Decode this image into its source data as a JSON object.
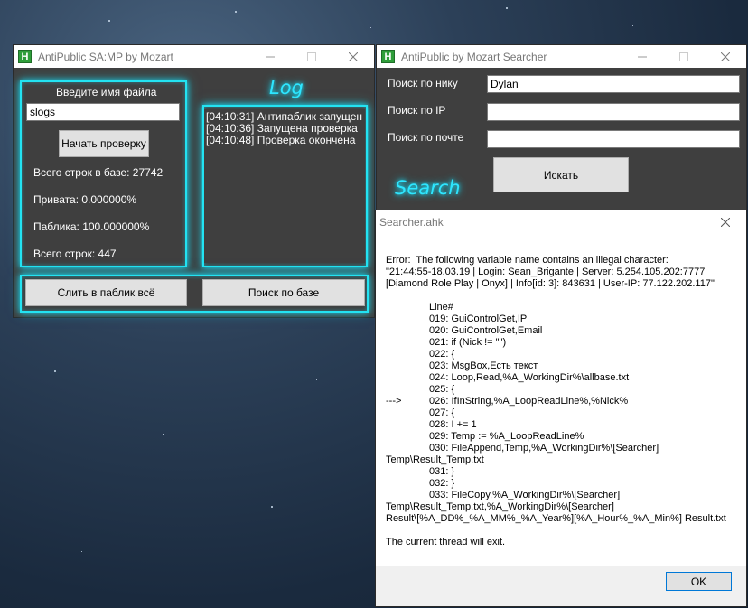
{
  "main_window": {
    "title": "AntiPublic SA:MP by Mozart",
    "file_label": "Введите имя файла",
    "file_value": "slogs",
    "check_button": "Начать проверку",
    "stats": {
      "total_base": "Всего строк в базе: 27742",
      "private": "Привата: 0.000000%",
      "public": "Паблика: 100.000000%",
      "total_lines": "Всего строк: 447"
    },
    "log_title": "Log",
    "log_lines": [
      "[04:10:31] Антипаблик запущен",
      "[04:10:36] Запущена проверка",
      "[04:10:48] Проверка окончена"
    ],
    "merge_button": "Слить в паблик всё",
    "search_db_button": "Поиск по базе"
  },
  "searcher_window": {
    "title": "AntiPublic by Mozart Searcher",
    "nick_label": "Поиск по нику",
    "nick_value": "Dylan",
    "ip_label": "Поиск по IP",
    "ip_value": "",
    "email_label": "Поиск по почте",
    "email_value": "",
    "search_button": "Искать",
    "glow_title": "Search"
  },
  "message_box": {
    "title": "Searcher.ahk",
    "error_lines": [
      "Error:  The following variable name contains an illegal character:",
      "\"21:44:55-18.03.19 | Login: Sean_Brigante | Server: 5.254.105.202:7777",
      "[Diamond Role Play | Onyx] | Info[id: 3]: 843631 | User-IP: 77.122.202.117\""
    ],
    "line_header": "Line#",
    "code_lines": [
      {
        "marker": "",
        "text": "019: GuiControlGet,IP"
      },
      {
        "marker": "",
        "text": "020: GuiControlGet,Email"
      },
      {
        "marker": "",
        "text": "021: if (Nick != \"\")"
      },
      {
        "marker": "",
        "text": "022: {"
      },
      {
        "marker": "",
        "text": "023: MsgBox,Есть текст"
      },
      {
        "marker": "",
        "text": "024: Loop,Read,%A_WorkingDir%\\allbase.txt"
      },
      {
        "marker": "",
        "text": "025: {"
      },
      {
        "marker": "--->",
        "text": "026: IfInString,%A_LoopReadLine%,%Nick%"
      },
      {
        "marker": "",
        "text": "027: {"
      },
      {
        "marker": "",
        "text": "028: I += 1"
      },
      {
        "marker": "",
        "text": "029: Temp := %A_LoopReadLine%"
      },
      {
        "marker": "",
        "text": "030: FileAppend,Temp,%A_WorkingDir%\\[Searcher]"
      }
    ],
    "wrap_1": "Temp\\Result_Temp.txt",
    "code_lines_2": [
      "031: }",
      "032: }",
      "033: FileCopy,%A_WorkingDir%\\[Searcher]"
    ],
    "wrap_2": "Temp\\Result_Temp.txt,%A_WorkingDir%\\[Searcher]",
    "wrap_3": "Result\\[%A_DD%_%A_MM%_%A_Year%][%A_Hour%_%A_Min%] Result.txt",
    "exit_text": "The current thread will exit.",
    "ok_button": "OK"
  }
}
